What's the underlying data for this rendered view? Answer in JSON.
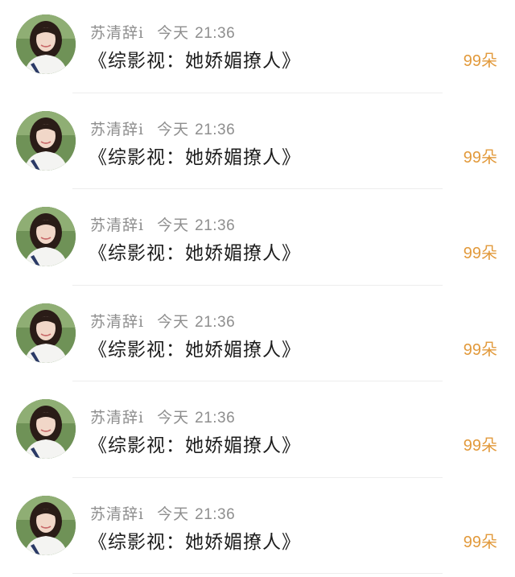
{
  "items": [
    {
      "author": "苏清辞i",
      "day": "今天",
      "time": "21:36",
      "title": "《综影视：她娇媚撩人》",
      "count": "99朵"
    },
    {
      "author": "苏清辞i",
      "day": "今天",
      "time": "21:36",
      "title": "《综影视：她娇媚撩人》",
      "count": "99朵"
    },
    {
      "author": "苏清辞i",
      "day": "今天",
      "time": "21:36",
      "title": "《综影视：她娇媚撩人》",
      "count": "99朵"
    },
    {
      "author": "苏清辞i",
      "day": "今天",
      "time": "21:36",
      "title": "《综影视：她娇媚撩人》",
      "count": "99朵"
    },
    {
      "author": "苏清辞i",
      "day": "今天",
      "time": "21:36",
      "title": "《综影视：她娇媚撩人》",
      "count": "99朵"
    },
    {
      "author": "苏清辞i",
      "day": "今天",
      "time": "21:36",
      "title": "《综影视：她娇媚撩人》",
      "count": "99朵"
    }
  ],
  "colors": {
    "meta": "#8e8e8e",
    "title": "#1d1d1d",
    "count": "#e29a3c",
    "divider": "#ededed"
  }
}
